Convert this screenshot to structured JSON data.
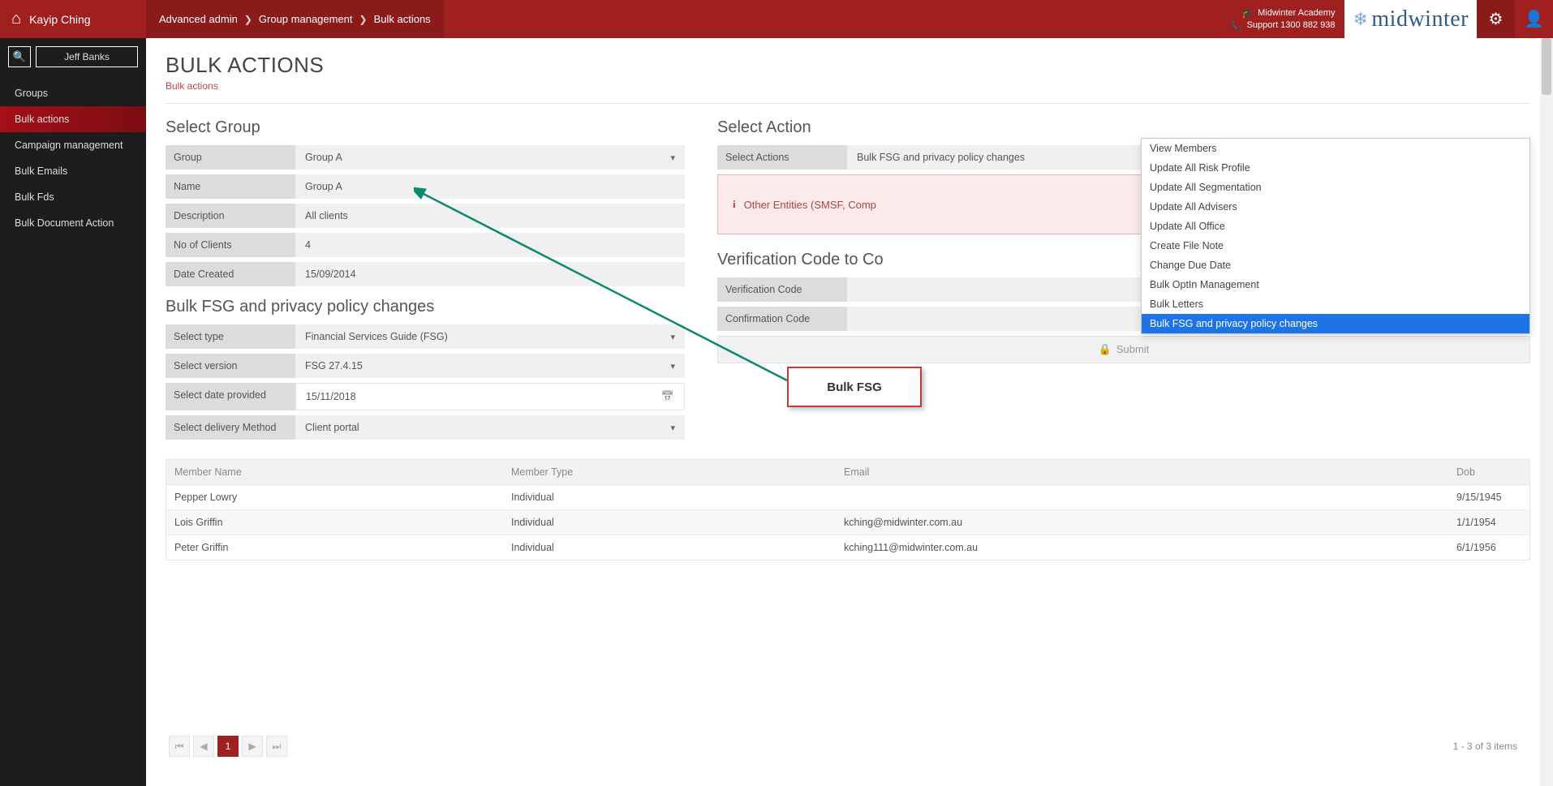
{
  "topbar": {
    "user": "Kayip Ching",
    "breadcrumb": [
      "Advanced admin",
      "Group management",
      "Bulk actions"
    ],
    "academy": "Midwinter Academy",
    "support": "Support 1300 882 938",
    "brand": "midwinter"
  },
  "sidebar": {
    "search_name": "Jeff Banks",
    "items": [
      "Groups",
      "Bulk actions",
      "Campaign management",
      "Bulk Emails",
      "Bulk Fds",
      "Bulk Document Action"
    ],
    "active_index": 1
  },
  "page": {
    "title": "BULK ACTIONS",
    "subtitle": "Bulk actions"
  },
  "select_group": {
    "heading": "Select Group",
    "rows": {
      "group_label": "Group",
      "group_value": "Group A",
      "name_label": "Name",
      "name_value": "Group A",
      "desc_label": "Description",
      "desc_value": "All clients",
      "count_label": "No of Clients",
      "count_value": "4",
      "date_label": "Date Created",
      "date_value": "15/09/2014"
    }
  },
  "bulk_fsg": {
    "heading": "Bulk FSG and privacy policy changes",
    "type_label": "Select type",
    "type_value": "Financial Services Guide (FSG)",
    "version_label": "Select version",
    "version_value": "FSG 27.4.15",
    "date_label": "Select date provided",
    "date_value": "15/11/2018",
    "delivery_label": "Select delivery Method",
    "delivery_value": "Client portal"
  },
  "select_action": {
    "heading": "Select Action",
    "label": "Select Actions",
    "value": "Bulk FSG and privacy policy changes",
    "options": [
      "View Members",
      "Update All Risk Profile",
      "Update All Segmentation",
      "Update All Advisers",
      "Update All Office",
      "Create File Note",
      "Change Due Date",
      "Bulk OptIn Management",
      "Bulk Letters",
      "Bulk FSG and privacy policy changes"
    ],
    "selected_index": 9
  },
  "banner": "Other Entities (SMSF, Comp",
  "verification": {
    "heading": "Verification Code to Co",
    "vc_label": "Verification Code",
    "cc_label": "Confirmation Code"
  },
  "submit": "Submit",
  "grid": {
    "headers": {
      "name": "Member Name",
      "type": "Member Type",
      "email": "Email",
      "dob": "Dob"
    },
    "rows": [
      {
        "name": "Pepper Lowry",
        "type": "Individual",
        "email": "",
        "dob": "9/15/1945"
      },
      {
        "name": "Lois Griffin",
        "type": "Individual",
        "email": "kching@midwinter.com.au",
        "dob": "1/1/1954"
      },
      {
        "name": "Peter Griffin",
        "type": "Individual",
        "email": "kching111@midwinter.com.au",
        "dob": "6/1/1956"
      }
    ]
  },
  "pager": {
    "page": "1",
    "summary": "1 - 3 of 3 items"
  },
  "callout": "Bulk FSG"
}
